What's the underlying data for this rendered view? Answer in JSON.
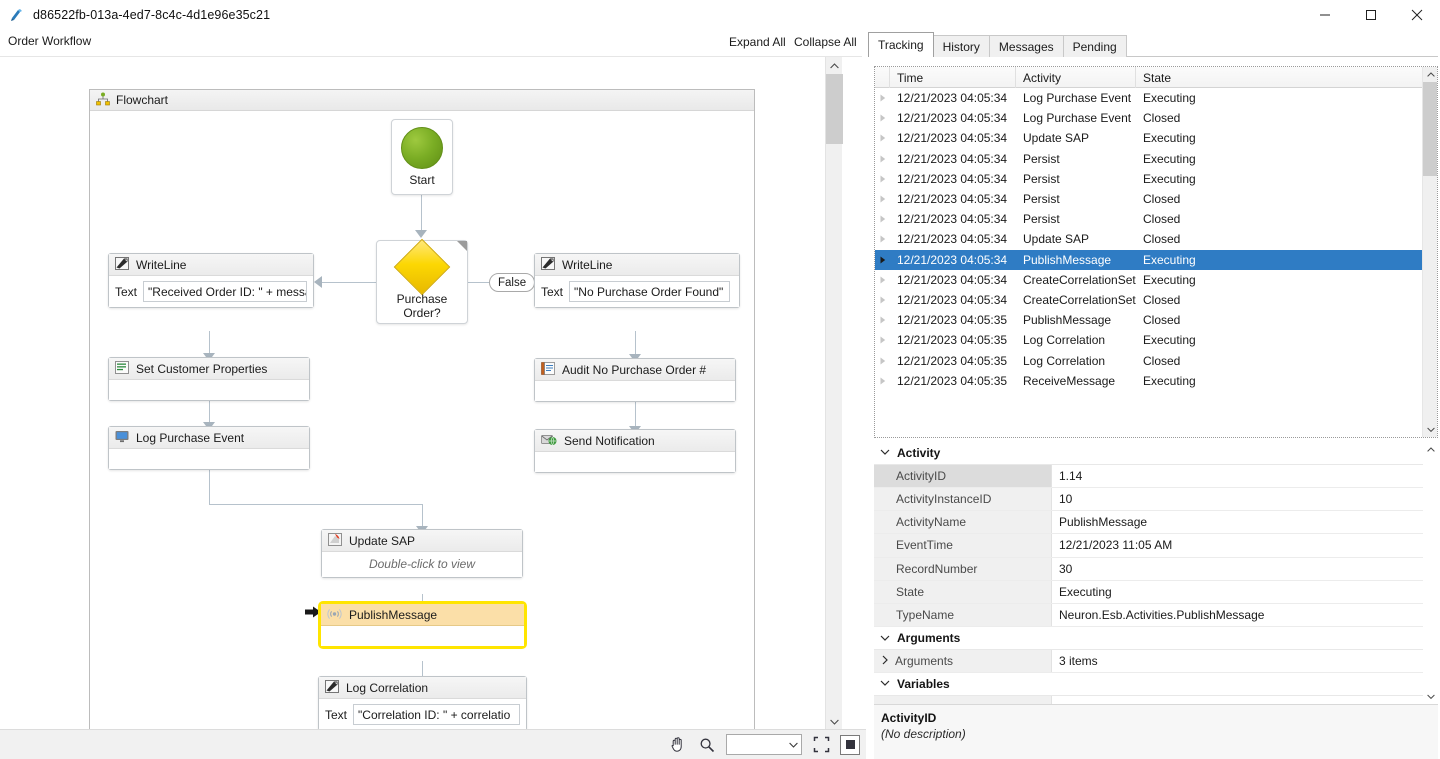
{
  "window": {
    "title": "d86522fb-013a-4ed7-8c4c-4d1e96e35c21",
    "app_icon": "workflow-icon",
    "minimize_label": "—",
    "maximize_label": "☐",
    "close_label": "✕"
  },
  "subbar": {
    "breadcrumb": "Order Workflow",
    "expand_all": "Expand All",
    "collapse_all": "Collapse All"
  },
  "designer": {
    "flowchart_label": "Flowchart",
    "flowchart_icon": "flowchart-icon",
    "nodes": {
      "start": {
        "label": "Start",
        "icon": "start-circle-icon"
      },
      "decision": {
        "label": "Purchase Order?",
        "icon": "decision-diamond-icon"
      },
      "false_pill": "False",
      "writeline_left": {
        "title": "WriteLine",
        "icon": "writeline-icon",
        "field_label": "Text",
        "field_value": "\"Received Order ID: \" + messa"
      },
      "writeline_right": {
        "title": "WriteLine",
        "icon": "writeline-icon",
        "field_label": "Text",
        "field_value": "\"No Purchase Order Found\""
      },
      "set_customer": {
        "title": "Set Customer Properties",
        "icon": "properties-icon"
      },
      "log_purchase": {
        "title": "Log Purchase Event",
        "icon": "monitor-icon"
      },
      "audit_no_po": {
        "title": "Audit No Purchase Order #",
        "icon": "audit-icon"
      },
      "send_notification": {
        "title": "Send Notification",
        "icon": "send-mail-icon"
      },
      "update_sap": {
        "title": "Update SAP",
        "icon": "sap-icon",
        "body": "Double-click to view"
      },
      "publish_message": {
        "title": "PublishMessage",
        "icon": "broadcast-icon"
      },
      "log_correlation": {
        "title": "Log Correlation",
        "icon": "writeline-icon",
        "field_label": "Text",
        "field_value": "\"Correlation ID: \" + correlatio"
      }
    },
    "toolbar": {
      "pan_icon": "hand-pan-icon",
      "zoom_icon": "magnifier-icon",
      "zoom_value": "",
      "zoom_placeholder": "",
      "fit_icon": "fit-to-screen-icon",
      "restore_icon": "restore-zoom-icon"
    }
  },
  "right_panel": {
    "tabs": [
      {
        "label": "Tracking",
        "active": true
      },
      {
        "label": "History",
        "active": false
      },
      {
        "label": "Messages",
        "active": false
      },
      {
        "label": "Pending",
        "active": false
      }
    ],
    "grid": {
      "columns": [
        "Time",
        "Activity",
        "State"
      ],
      "rows": [
        {
          "time": "12/21/2023 04:05:34",
          "activity": "Log Purchase Event",
          "state": "Executing",
          "selected": false
        },
        {
          "time": "12/21/2023 04:05:34",
          "activity": "Log Purchase Event",
          "state": "Closed",
          "selected": false
        },
        {
          "time": "12/21/2023 04:05:34",
          "activity": "Update SAP",
          "state": "Executing",
          "selected": false
        },
        {
          "time": "12/21/2023 04:05:34",
          "activity": "Persist",
          "state": "Executing",
          "selected": false
        },
        {
          "time": "12/21/2023 04:05:34",
          "activity": "Persist",
          "state": "Executing",
          "selected": false
        },
        {
          "time": "12/21/2023 04:05:34",
          "activity": "Persist",
          "state": "Closed",
          "selected": false
        },
        {
          "time": "12/21/2023 04:05:34",
          "activity": "Persist",
          "state": "Closed",
          "selected": false
        },
        {
          "time": "12/21/2023 04:05:34",
          "activity": "Update SAP",
          "state": "Closed",
          "selected": false
        },
        {
          "time": "12/21/2023 04:05:34",
          "activity": "PublishMessage",
          "state": "Executing",
          "selected": true
        },
        {
          "time": "12/21/2023 04:05:34",
          "activity": "CreateCorrelationSet",
          "state": "Executing",
          "selected": false
        },
        {
          "time": "12/21/2023 04:05:34",
          "activity": "CreateCorrelationSet",
          "state": "Closed",
          "selected": false
        },
        {
          "time": "12/21/2023 04:05:35",
          "activity": "PublishMessage",
          "state": "Closed",
          "selected": false
        },
        {
          "time": "12/21/2023 04:05:35",
          "activity": "Log Correlation",
          "state": "Executing",
          "selected": false
        },
        {
          "time": "12/21/2023 04:05:35",
          "activity": "Log Correlation",
          "state": "Closed",
          "selected": false
        },
        {
          "time": "12/21/2023 04:05:35",
          "activity": "ReceiveMessage",
          "state": "Executing",
          "selected": false
        }
      ]
    },
    "properties": {
      "categories": [
        {
          "name": "Activity",
          "expanded": true,
          "rows": [
            {
              "name": "ActivityID",
              "value": "1.14",
              "selected": true
            },
            {
              "name": "ActivityInstanceID",
              "value": "10",
              "selected": false
            },
            {
              "name": "ActivityName",
              "value": "PublishMessage",
              "selected": false
            },
            {
              "name": "EventTime",
              "value": "12/21/2023 11:05 AM",
              "selected": false
            },
            {
              "name": "RecordNumber",
              "value": "30",
              "selected": false
            },
            {
              "name": "State",
              "value": "Executing",
              "selected": false
            },
            {
              "name": "TypeName",
              "value": "Neuron.Esb.Activities.PublishMessage",
              "selected": false
            }
          ]
        },
        {
          "name": "Arguments",
          "expanded": true,
          "rows": [
            {
              "name": "Arguments",
              "value": "3 items",
              "selected": false,
              "expandable": true
            }
          ]
        },
        {
          "name": "Variables",
          "expanded": true,
          "rows": []
        }
      ]
    },
    "description": {
      "title": "ActivityID",
      "text": "(No description)"
    }
  },
  "colors": {
    "selection_blue": "#2f7cc4",
    "highlight_yellow": "#ffe500",
    "highlight_fill": "#fbdfa8",
    "start_green": "#7aad24",
    "decision_yellow": "#fcd703",
    "connector_gray": "#b6c2cc"
  }
}
